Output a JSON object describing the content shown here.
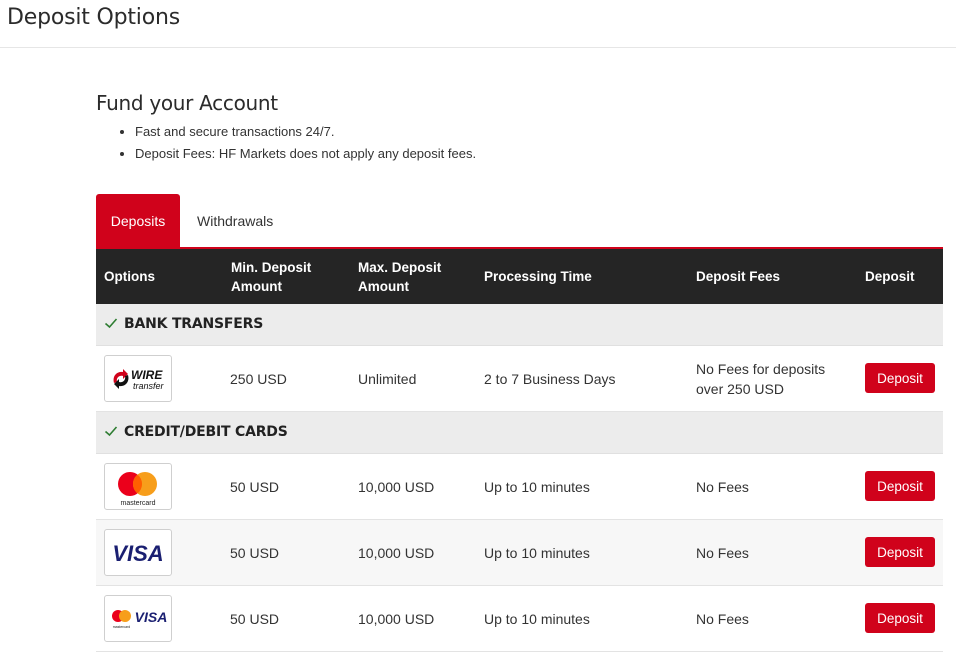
{
  "page": {
    "title": "Deposit Options"
  },
  "fund": {
    "title": "Fund your Account",
    "bullets": [
      "Fast and secure transactions 24/7.",
      "Deposit Fees:  HF Markets does not apply any deposit fees."
    ]
  },
  "tabs": [
    {
      "label": "Deposits",
      "active": true
    },
    {
      "label": "Withdrawals",
      "active": false
    }
  ],
  "table": {
    "headers": {
      "options": "Options",
      "min": "Min. Deposit Amount",
      "max": "Max. Deposit Amount",
      "time": "Processing Time",
      "fees": "Deposit Fees",
      "deposit": "Deposit"
    },
    "groups": [
      {
        "label": "BANK TRANSFERS",
        "rows": [
          {
            "logo": "wire-transfer-logo",
            "logo_text": [
              "WIRE",
              "transfer"
            ],
            "min": "250 USD",
            "max": "Unlimited",
            "time": "2 to 7 Business Days",
            "fees": "No Fees for deposits over 250 USD",
            "button": "Deposit"
          }
        ]
      },
      {
        "label": "CREDIT/DEBIT CARDS",
        "rows": [
          {
            "logo": "mastercard-logo",
            "logo_text": [
              "mastercard"
            ],
            "min": "50 USD",
            "max": "10,000 USD",
            "time": "Up to 10 minutes",
            "fees": "No Fees",
            "button": "Deposit"
          },
          {
            "logo": "visa-logo",
            "logo_text": [
              "VISA"
            ],
            "min": "50 USD",
            "max": "10,000 USD",
            "time": "Up to 10 minutes",
            "fees": "No Fees",
            "button": "Deposit"
          },
          {
            "logo": "mastercard-visa-logo",
            "logo_text": [
              "VISA",
              "mastercard"
            ],
            "min": "50 USD",
            "max": "10,000 USD",
            "time": "Up to 10 minutes",
            "fees": "No Fees",
            "button": "Deposit"
          }
        ]
      }
    ]
  },
  "colors": {
    "accent": "#d0021b",
    "header_bg": "#252525",
    "group_bg": "#ececec",
    "check": "#2e7d32"
  },
  "icons": {
    "group_marker": "check-icon"
  }
}
